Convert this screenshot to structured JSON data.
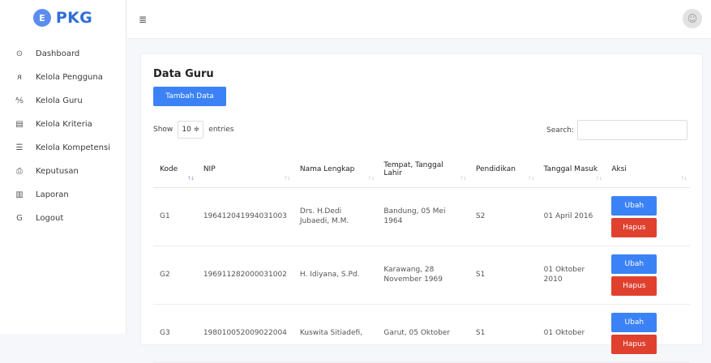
{
  "brand": {
    "badge": "E",
    "name": "PKG"
  },
  "sidebar": {
    "items": [
      {
        "icon": "⊙",
        "label": "Dashboard"
      },
      {
        "icon": "ᴙ",
        "label": "Kelola Pengguna"
      },
      {
        "icon": "⅍",
        "label": "Kelola Guru"
      },
      {
        "icon": "▤",
        "label": "Kelola Kriteria"
      },
      {
        "icon": "☰",
        "label": "Kelola Kompetensi"
      },
      {
        "icon": "⎙",
        "label": "Keputusan"
      },
      {
        "icon": "▥",
        "label": "Laporan"
      },
      {
        "icon": "G",
        "label": "Logout"
      }
    ]
  },
  "topbar": {
    "menu_icon": "≣",
    "avatar_icon": "☺"
  },
  "main": {
    "title": "Data Guru",
    "add_button": "Tambah Data",
    "show_label": "Show",
    "entries_value": "10 ≑",
    "entries_label": "entries",
    "search_label": "Search:",
    "columns": [
      "Kode",
      "NIP",
      "Nama Lengkap",
      "Tempat, Tanggal Lahir",
      "Pendidikan",
      "Tanggal Masuk",
      "Aksi"
    ],
    "rows": [
      {
        "kode": "G1",
        "nip": "196412041994031003",
        "nama": "Drs. H.Dedi Jubaedi, M.M.",
        "ttl": "Bandung, 05 Mei 1964",
        "pendidikan": "S2",
        "masuk": "01 April 2016"
      },
      {
        "kode": "G2",
        "nip": "196911282000031002",
        "nama": "H. Idiyana, S.Pd.",
        "ttl": "Karawang, 28 November 1969",
        "pendidikan": "S1",
        "masuk": "01 Oktober 2010"
      },
      {
        "kode": "G3",
        "nip": "198010052009022004",
        "nama": "Kuswita Sitiadefi,",
        "ttl": "Garut, 05 Oktober",
        "pendidikan": "S1",
        "masuk": "01 Oktober"
      }
    ],
    "edit_label": "Ubah",
    "delete_label": "Hapus"
  }
}
